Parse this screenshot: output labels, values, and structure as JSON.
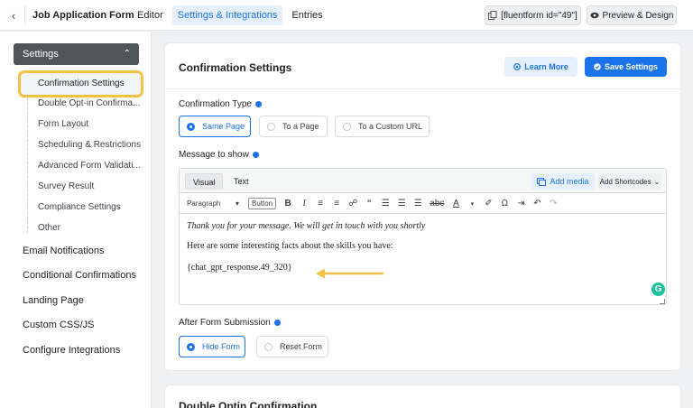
{
  "topbar": {
    "back_icon": "chevron-left-icon",
    "form_title": "Job Application Form",
    "tabs": [
      {
        "label": "Editor",
        "active": false
      },
      {
        "label": "Settings & Integrations",
        "active": true
      },
      {
        "label": "Entries",
        "active": false
      }
    ],
    "shortcode": "[fluentform id=\"49\"]",
    "preview_label": "Preview & Design"
  },
  "sidebar": {
    "settings_label": "Settings",
    "sub_items": [
      "Confirmation Settings",
      "Double Opt-in Confirma...",
      "Form Layout",
      "Scheduling & Restrictions",
      "Advanced Form Validati...",
      "Survey Result",
      "Compliance Settings",
      "Other"
    ],
    "active_sub_item": "Confirmation Settings",
    "main_items": [
      "Email Notifications",
      "Conditional Confirmations",
      "Landing Page",
      "Custom CSS/JS",
      "Configure Integrations"
    ]
  },
  "panel": {
    "title": "Confirmation Settings",
    "learn_more": "Learn More",
    "save": "Save Settings",
    "confirmation_type_label": "Confirmation Type",
    "confirmation_types": [
      "Same Page",
      "To a Page",
      "To a Custom URL"
    ],
    "selected_confirmation_type": "Same Page",
    "message_label": "Message to show",
    "editor": {
      "tab_visual": "Visual",
      "tab_text": "Text",
      "add_media": "Add media",
      "add_shortcodes": "Add Shortcodes",
      "format_select": "Paragraph",
      "button_label": "Button",
      "lines": [
        "Thank you for your message. We will get in touch with you shortly",
        "Here are some interesting facts about the skills you have:",
        "{chat_gpt_response.49_320}"
      ]
    },
    "after_submission_label": "After Form Submission",
    "after_submission_options": [
      "Hide Form",
      "Reset Form"
    ],
    "selected_after_submission": "Hide Form"
  },
  "panel2": {
    "title": "Double Optin Confirmation"
  },
  "colors": {
    "accent": "#1a73e8",
    "highlight": "#f3c244",
    "sidebar_header": "#50555c"
  }
}
